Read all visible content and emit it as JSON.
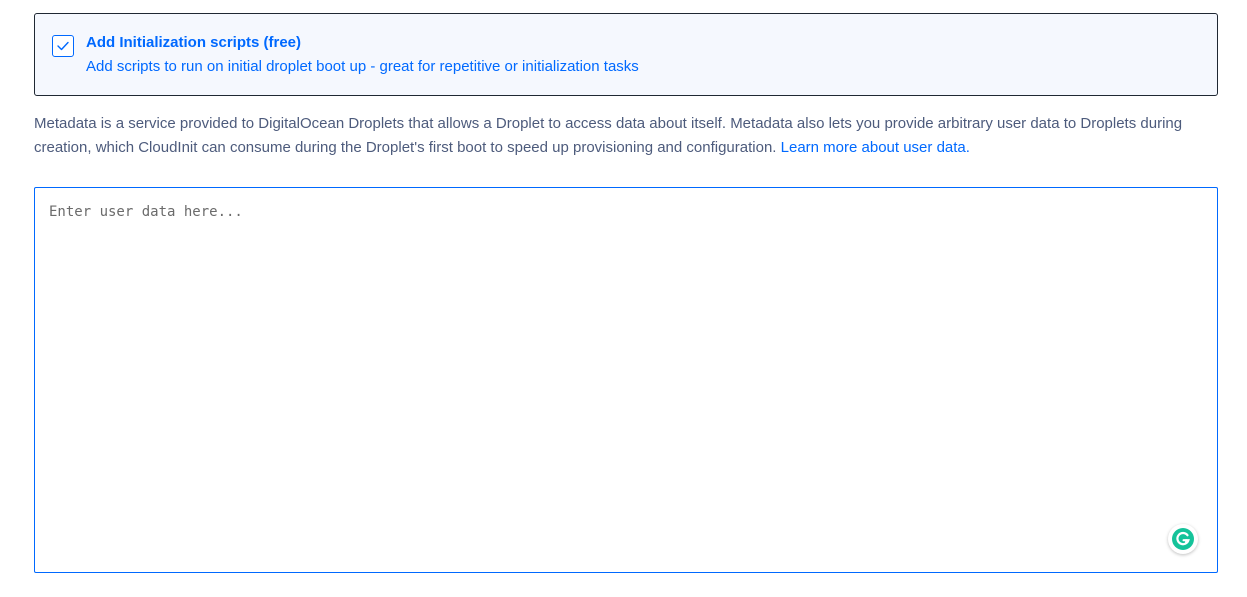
{
  "init_scripts": {
    "checked": true,
    "title": "Add Initialization scripts (free)",
    "subtitle": "Add scripts to run on initial droplet boot up - great for repetitive or initialization tasks"
  },
  "metadata_info": {
    "text": "Metadata is a service provided to DigitalOcean Droplets that allows a Droplet to access data about itself. Metadata also lets you provide arbitrary user data to Droplets during creation, which CloudInit can consume during the Droplet's first boot to speed up provisioning and configuration.",
    "link_label": "Learn more about user data."
  },
  "user_data": {
    "value": "",
    "placeholder": "Enter user data here..."
  },
  "icons": {
    "checkbox": "checkmark-icon",
    "grammarly": "grammarly-icon"
  },
  "colors": {
    "accent": "#0069ff",
    "card_background": "#f5f8fe",
    "body_text": "#4d5b7c",
    "grammarly": "#15c39a"
  }
}
